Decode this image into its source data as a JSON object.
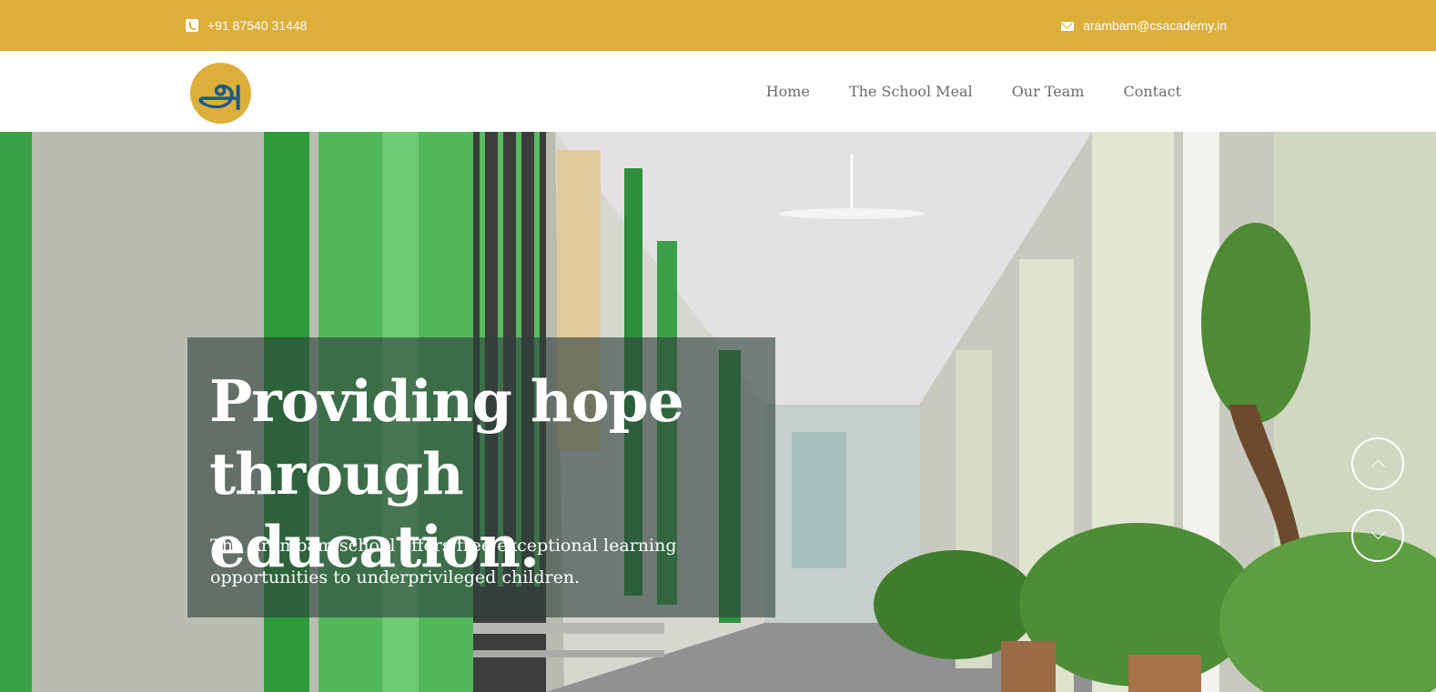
{
  "topbar": {
    "phone": "+91 87540 31448",
    "phone_icon": "phone-icon",
    "email": "arambam@csacademy.in",
    "email_icon": "envelope-icon",
    "background": "#dcae3a"
  },
  "header": {
    "logo_text": "அ",
    "nav": [
      {
        "label": "Home"
      },
      {
        "label": "The School Meal"
      },
      {
        "label": "Our Team"
      },
      {
        "label": "Contact"
      }
    ]
  },
  "hero": {
    "headline": "Providing hope through education.",
    "subtext": "The Arambam school offers free exceptional learning opportunities to underprivileged children.",
    "controls": {
      "prev_icon": "chevron-up-icon",
      "next_icon": "chevron-down-icon"
    }
  }
}
